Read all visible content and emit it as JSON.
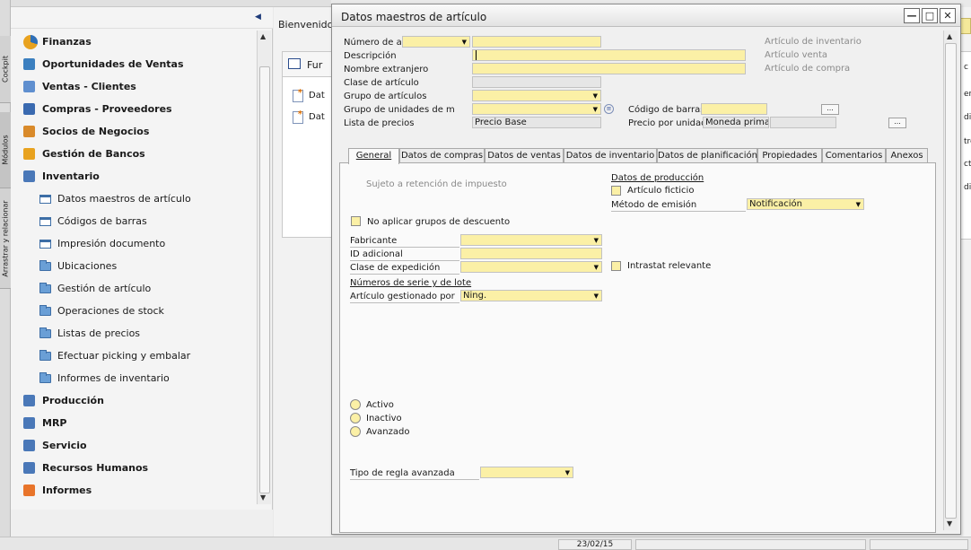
{
  "side_tabs": [
    "Cockpit",
    "Módulos",
    "Arrastrar y relacionar"
  ],
  "menu": {
    "items": [
      {
        "label": "Finanzas",
        "level": "module",
        "icon": "finance-pie-icon"
      },
      {
        "label": "Oportunidades de Ventas",
        "level": "module",
        "icon": "opportunities-icon"
      },
      {
        "label": "Ventas - Clientes",
        "level": "module",
        "icon": "sales-tag-icon"
      },
      {
        "label": "Compras - Proveedores",
        "level": "module",
        "icon": "shopping-cart-icon"
      },
      {
        "label": "Socios de Negocios",
        "level": "module",
        "icon": "business-partners-icon"
      },
      {
        "label": "Gestión de Bancos",
        "level": "module",
        "icon": "bank-icon"
      },
      {
        "label": "Inventario",
        "level": "module",
        "icon": "inventory-icon"
      },
      {
        "label": "Datos maestros de artículo",
        "level": "sub",
        "icon": "document-icon"
      },
      {
        "label": "Códigos de barras",
        "level": "sub",
        "icon": "document-icon"
      },
      {
        "label": "Impresión documento",
        "level": "sub",
        "icon": "document-icon"
      },
      {
        "label": "Ubicaciones",
        "level": "sub",
        "icon": "folder-icon"
      },
      {
        "label": "Gestión de artículo",
        "level": "sub",
        "icon": "folder-icon"
      },
      {
        "label": "Operaciones de stock",
        "level": "sub",
        "icon": "folder-icon"
      },
      {
        "label": "Listas de precios",
        "level": "sub",
        "icon": "folder-icon"
      },
      {
        "label": "Efectuar picking y embalar",
        "level": "sub",
        "icon": "folder-icon"
      },
      {
        "label": "Informes de inventario",
        "level": "sub",
        "icon": "folder-icon"
      },
      {
        "label": "Producción",
        "level": "module",
        "icon": "production-icon"
      },
      {
        "label": "MRP",
        "level": "module",
        "icon": "mrp-icon"
      },
      {
        "label": "Servicio",
        "level": "module",
        "icon": "service-icon"
      },
      {
        "label": "Recursos Humanos",
        "level": "module",
        "icon": "human-resources-icon"
      },
      {
        "label": "Informes",
        "level": "module",
        "icon": "reports-icon"
      }
    ]
  },
  "workspace": {
    "welcome": "Bienvenido,",
    "cockpit_title": "Fur",
    "cockpit_rows": [
      "Dat",
      "Dat"
    ],
    "right_edge_letters": [
      "c",
      "er",
      "di",
      "tre",
      "ctu",
      "di"
    ]
  },
  "dialog": {
    "title": "Datos maestros de artículo",
    "window_buttons": {
      "minimize": "—",
      "maximize": "□",
      "close": "✕"
    },
    "header": {
      "numero_label": "Número de ar",
      "descripcion_label": "Descripción",
      "nombre_extranjero_label": "Nombre extranjero",
      "clase_articulo_label": "Clase de artículo",
      "grupo_articulos_label": "Grupo de artículos",
      "grupo_unidades_label": "Grupo de unidades de m",
      "lista_precios_label": "Lista de precios",
      "lista_precios_value": "Precio Base",
      "codigo_barras_label": "Código de barras",
      "precio_unidad_label": "Precio por unidad",
      "moneda_value": "Moneda primaria",
      "articulo_inventario": "Artículo de inventario",
      "articulo_venta": "Artículo venta",
      "articulo_compra": "Artículo de compra",
      "ellipsis": "..."
    },
    "tabs": [
      "General",
      "Datos de compras",
      "Datos de ventas",
      "Datos de inventario",
      "Datos de planificación",
      "Propiedades",
      "Comentarios",
      "Anexos"
    ],
    "general": {
      "retencion": "Sujeto a retención de impuesto",
      "no_aplicar": "No aplicar grupos de descuento",
      "fabricante_label": "Fabricante",
      "id_adicional_label": "ID adicional",
      "clase_expedicion_label": "Clase de expedición",
      "intrastat": "Intrastat relevante",
      "series_lotes": "Números de serie y de lote",
      "gestionado_label": "Artículo gestionado por",
      "gestionado_value": "Ning.",
      "datos_produccion": "Datos de producción",
      "articulo_ficticio": "Artículo ficticio",
      "metodo_emision_label": "Método de emisión",
      "metodo_emision_value": "Notificación",
      "status_options": [
        "Activo",
        "Inactivo",
        "Avanzado"
      ],
      "tipo_regla_label": "Tipo de regla avanzada"
    }
  },
  "statusbar": {
    "date": "23/02/15"
  }
}
